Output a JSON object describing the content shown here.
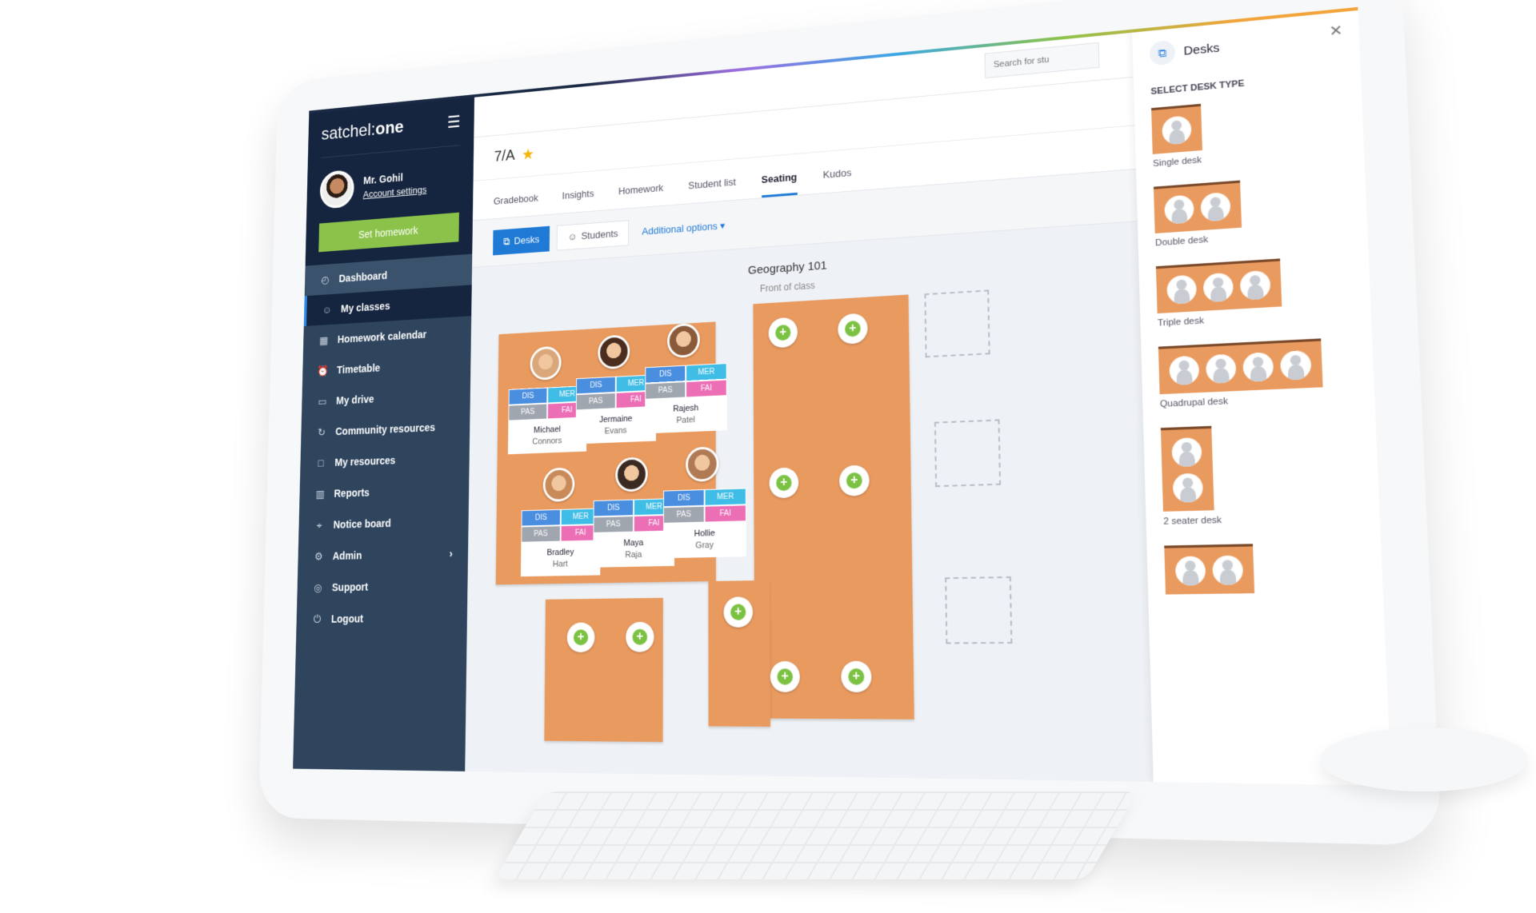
{
  "app": {
    "logo_light": "satchel:",
    "logo_bold": "one"
  },
  "user": {
    "name": "Mr. Gohil",
    "account_link": "Account settings"
  },
  "sidebar": {
    "set_homework": "Set homework",
    "items": [
      {
        "label": "Dashboard",
        "icon": "gauge-icon"
      },
      {
        "label": "My classes",
        "icon": "users-icon"
      },
      {
        "label": "Homework calendar",
        "icon": "calendar-icon"
      },
      {
        "label": "Timetable",
        "icon": "alarm-clock-icon"
      },
      {
        "label": "My drive",
        "icon": "drive-icon"
      },
      {
        "label": "Community resources",
        "icon": "refresh-icon"
      },
      {
        "label": "My resources",
        "icon": "folder-icon"
      },
      {
        "label": "Reports",
        "icon": "chart-icon"
      },
      {
        "label": "Notice board",
        "icon": "pin-icon"
      },
      {
        "label": "Admin",
        "icon": "gear-icon"
      },
      {
        "label": "Support",
        "icon": "lifebuoy-icon"
      },
      {
        "label": "Logout",
        "icon": "power-icon"
      }
    ],
    "active": "My classes"
  },
  "header": {
    "search_placeholder": "Search for stu"
  },
  "class": {
    "title": "7/A",
    "favorite": true
  },
  "tabs": [
    {
      "label": "Gradebook"
    },
    {
      "label": "Insights"
    },
    {
      "label": "Homework"
    },
    {
      "label": "Student list"
    },
    {
      "label": "Seating",
      "active": true
    },
    {
      "label": "Kudos"
    }
  ],
  "toolbar": {
    "desks": "Desks",
    "students": "Students",
    "additional": "Additional options"
  },
  "room": {
    "title": "Geography 101",
    "front": "Front of class"
  },
  "tags": [
    "DIS",
    "MER",
    "PAS",
    "FAI"
  ],
  "students": [
    {
      "first": "Michael",
      "last": "Connors"
    },
    {
      "first": "Jermaine",
      "last": "Evans"
    },
    {
      "first": "Rajesh",
      "last": "Patel"
    },
    {
      "first": "Bradley",
      "last": "Hart"
    },
    {
      "first": "Maya",
      "last": "Raja"
    },
    {
      "first": "Hollie",
      "last": "Gray"
    }
  ],
  "panel": {
    "title": "Desks",
    "subtitle": "SELECT DESK TYPE",
    "types": [
      {
        "label": "Single desk",
        "seats": 1
      },
      {
        "label": "Double desk",
        "seats": 2
      },
      {
        "label": "Triple desk",
        "seats": 3
      },
      {
        "label": "Quadrupal desk",
        "seats": 4
      },
      {
        "label": "2 seater desk",
        "seats": 2
      },
      {
        "label": "",
        "seats": 2
      }
    ]
  },
  "colors": {
    "sidebar": "#2f455e",
    "sidebar_dark": "#15253f",
    "accent": "#1f7ad6",
    "green": "#8bc34a",
    "desk": "#e99a5f",
    "dis": "#4a8ee0",
    "mer": "#3fbde6",
    "pas": "#a0a6af",
    "fai": "#ec6fb6"
  }
}
